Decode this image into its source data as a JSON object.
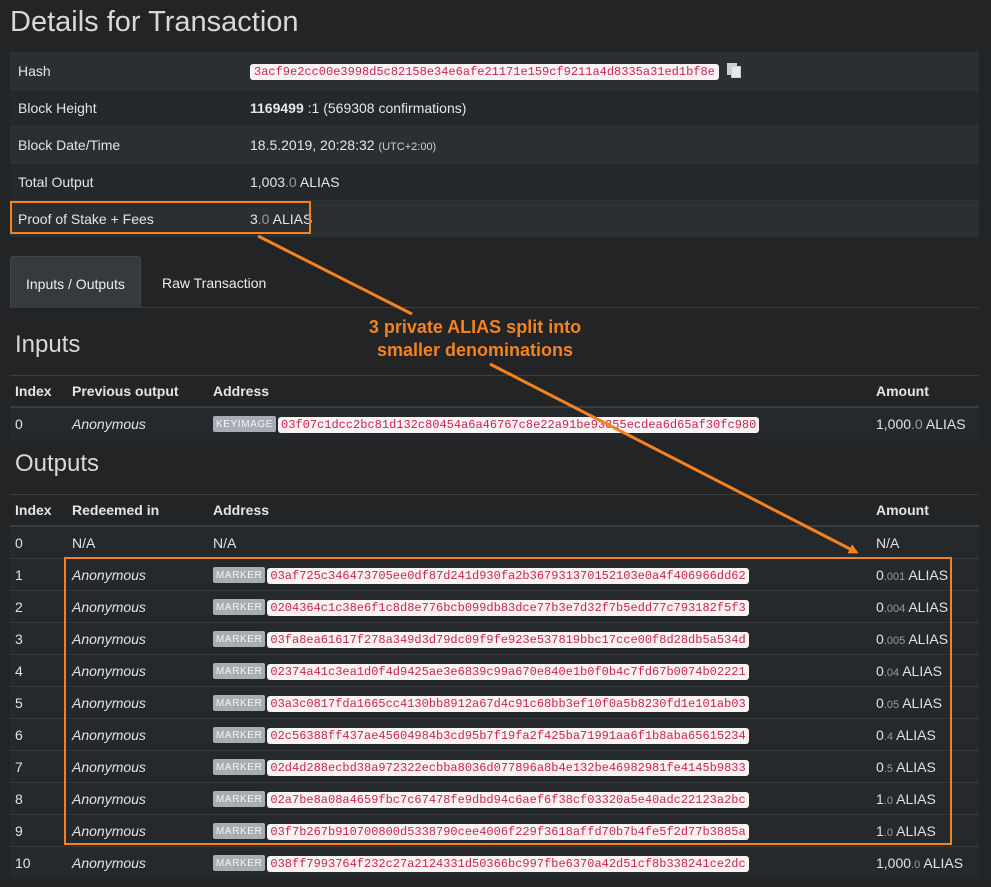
{
  "page_title": "Details for Transaction",
  "details": {
    "hash_label": "Hash",
    "hash_value": "3acf9e2cc00e3998d5c82158e34e6afe21171e159cf9211a4d8335a31ed1bf8e",
    "height_label": "Block Height",
    "height_value": "1169499",
    "height_suffix": ":1",
    "height_confirmations": "(569308 confirmations)",
    "datetime_label": "Block Date/Time",
    "datetime_value": "18.5.2019, 20:28:32",
    "datetime_tz": "(UTC+2:00)",
    "total_label": "Total Output",
    "total_int": "1,003",
    "total_dec": ".0",
    "total_unit": "ALIAS",
    "pos_label": "Proof of Stake + Fees",
    "pos_int": "3",
    "pos_dec": ".0",
    "pos_unit": "ALIAS"
  },
  "tabs": {
    "io": "Inputs / Outputs",
    "raw": "Raw Transaction"
  },
  "annotation": {
    "line1": "3 private ALIAS split into",
    "line2": "smaller denominations"
  },
  "colors": {
    "highlight": "#f58220",
    "background": "#222426",
    "hash_text": "#c7254e"
  },
  "inputs": {
    "title": "Inputs",
    "headers": {
      "index": "Index",
      "prev": "Previous output",
      "address": "Address",
      "amount": "Amount"
    },
    "rows": [
      {
        "index": "0",
        "prev": "Anonymous",
        "tag": "KEYIMAGE",
        "address": "03f07c1dcc2bc81d132c80454a6a46767c8e22a91be93855ecdea6d65af30fc980",
        "amount_int": "1,000",
        "amount_dec": ".0",
        "unit": "ALIAS"
      }
    ]
  },
  "outputs": {
    "title": "Outputs",
    "headers": {
      "index": "Index",
      "redeemed": "Redeemed in",
      "address": "Address",
      "amount": "Amount"
    },
    "row0": {
      "index": "0",
      "redeemed": "N/A",
      "address": "N/A",
      "amount": "N/A"
    },
    "rows": [
      {
        "index": "1",
        "redeemed": "Anonymous",
        "tag": "MARKER",
        "address": "03af725c346473705ee0df87d241d930fa2b367931370152103e0a4f406966dd62",
        "amount_int": "0",
        "amount_dec": ".001",
        "unit": "ALIAS"
      },
      {
        "index": "2",
        "redeemed": "Anonymous",
        "tag": "MARKER",
        "address": "0204364c1c38e6f1c8d8e776bcb099db83dce77b3e7d32f7b5edd77c793182f5f3",
        "amount_int": "0",
        "amount_dec": ".004",
        "unit": "ALIAS"
      },
      {
        "index": "3",
        "redeemed": "Anonymous",
        "tag": "MARKER",
        "address": "03fa8ea61617f278a349d3d79dc09f9fe923e537819bbc17cce00f8d28db5a534d",
        "amount_int": "0",
        "amount_dec": ".005",
        "unit": "ALIAS"
      },
      {
        "index": "4",
        "redeemed": "Anonymous",
        "tag": "MARKER",
        "address": "02374a41c3ea1d0f4d9425ae3e6839c99a670e840e1b0f0b4c7fd67b0074b02221",
        "amount_int": "0",
        "amount_dec": ".04",
        "unit": "ALIAS"
      },
      {
        "index": "5",
        "redeemed": "Anonymous",
        "tag": "MARKER",
        "address": "03a3c0817fda1665cc4130bb8912a67d4c91c68bb3ef10f0a5b8230fd1e101ab03",
        "amount_int": "0",
        "amount_dec": ".05",
        "unit": "ALIAS"
      },
      {
        "index": "6",
        "redeemed": "Anonymous",
        "tag": "MARKER",
        "address": "02c56388ff437ae45604984b3cd95b7f19fa2f425ba71991aa6f1b8aba65615234",
        "amount_int": "0",
        "amount_dec": ".4",
        "unit": "ALIAS"
      },
      {
        "index": "7",
        "redeemed": "Anonymous",
        "tag": "MARKER",
        "address": "02d4d288ecbd38a972322ecbba8036d077896a8b4e132be46982981fe4145b9833",
        "amount_int": "0",
        "amount_dec": ".5",
        "unit": "ALIAS"
      },
      {
        "index": "8",
        "redeemed": "Anonymous",
        "tag": "MARKER",
        "address": "02a7be8a08a4659fbc7c67478fe9dbd94c6aef6f38cf03320a5e40adc22123a2bc",
        "amount_int": "1",
        "amount_dec": ".0",
        "unit": "ALIAS"
      },
      {
        "index": "9",
        "redeemed": "Anonymous",
        "tag": "MARKER",
        "address": "03f7b267b910700800d5338790cee4006f229f3618affd70b7b4fe5f2d77b3885a",
        "amount_int": "1",
        "amount_dec": ".0",
        "unit": "ALIAS"
      },
      {
        "index": "10",
        "redeemed": "Anonymous",
        "tag": "MARKER",
        "address": "038ff7993764f232c27a2124331d50366bc997fbe6370a42d51cf8b338241ce2dc",
        "amount_int": "1,000",
        "amount_dec": ".0",
        "unit": "ALIAS"
      }
    ]
  }
}
